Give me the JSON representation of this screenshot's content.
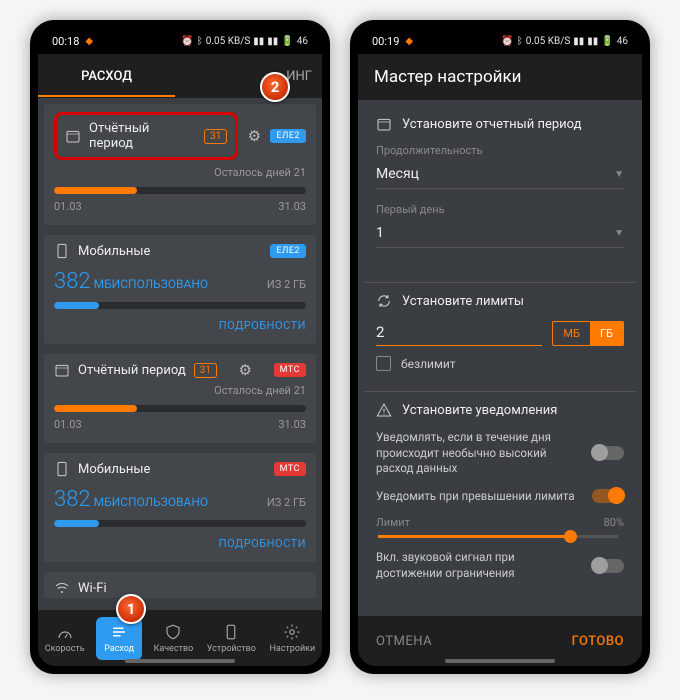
{
  "colors": {
    "accent": "#FF7A00",
    "blue": "#2E9BF0",
    "red": "#E53935",
    "danger": "#D90000"
  },
  "left": {
    "statusbar": {
      "time": "00:18",
      "speed": "0.05 KB/S",
      "battery": "46"
    },
    "tabs": {
      "active": "РАСХОД",
      "next_partial": "ИНГ"
    },
    "annotation": {
      "one": "1",
      "two": "2"
    },
    "card1": {
      "report_label": "Отчётный период",
      "report_badge": "31",
      "operator_chip": "ЕЛЕ2",
      "days_left": "Осталось дней 21",
      "start_date": "01.03",
      "end_date": "31.03",
      "progress_pct": 33
    },
    "mobile1": {
      "title": "Мобильные",
      "chip": "ЕЛЕ2",
      "amount": "382",
      "used_label": "МБИСПОЛЬЗОВАНО",
      "total": "ИЗ 2 ГБ",
      "progress_pct": 18,
      "details": "ПОДРОБНОСТИ"
    },
    "card2": {
      "report_label": "Отчётный период",
      "report_badge": "31",
      "operator_chip": "МТС",
      "days_left": "Осталось дней 21",
      "start_date": "01.03",
      "end_date": "31.03",
      "progress_pct": 33
    },
    "mobile2": {
      "title": "Мобильные",
      "chip": "МТС",
      "amount": "382",
      "used_label": "МБИСПОЛЬЗОВАНО",
      "total": "ИЗ 2 ГБ",
      "progress_pct": 18,
      "details": "ПОДРОБНОСТИ"
    },
    "wifi_partial": "Wi-Fi",
    "bottomnav": {
      "speed": "Скорость",
      "usage": "Расход",
      "quality": "Качество",
      "device": "Устройство",
      "settings": "Настройки"
    }
  },
  "right": {
    "statusbar": {
      "time": "00:19",
      "speed": "0.05 KB/S",
      "battery": "46"
    },
    "title": "Мастер настройки",
    "section1": {
      "heading": "Установите отчетный период",
      "duration_label": "Продолжительность",
      "duration_value": "Месяц",
      "first_day_label": "Первый день",
      "first_day_value": "1"
    },
    "section2": {
      "heading": "Установите лимиты",
      "value": "2",
      "unit_mb": "МБ",
      "unit_gb": "ГБ",
      "unlimited": "безлимит"
    },
    "section3": {
      "heading": "Установите уведомления",
      "n1": "Уведомлять, если в течение дня происходит необычно высокий расход данных",
      "n2": "Уведомить при превышении лимита",
      "limit_label": "Лимит",
      "limit_pct": "80%",
      "slider_pct": 80,
      "n3": "Вкл. звуковой сигнал при достижении ограничения"
    },
    "footer": {
      "cancel": "ОТМЕНА",
      "done": "ГОТОВО"
    }
  }
}
